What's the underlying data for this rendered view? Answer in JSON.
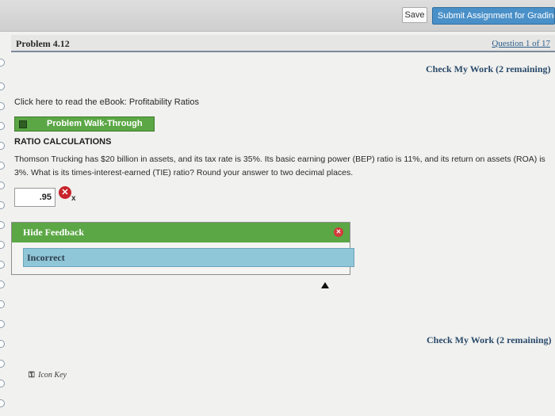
{
  "toolbar": {
    "save_label": "Save",
    "submit_label": "Submit Assignment for Grading",
    "accent_color": "#4a90c8"
  },
  "header": {
    "problem_title": "Problem 4.12",
    "question_nav": "Question 1 of 17"
  },
  "check_work": {
    "top_label": "Check My Work (2 remaining)",
    "bottom_label": "Check My Work (2 remaining)"
  },
  "content": {
    "ebook_link": "Click here to read the eBook: Profitability Ratios",
    "walkthrough_label": "Problem Walk-Through",
    "section_heading": "RATIO CALCULATIONS",
    "question": "Thomson Trucking has $20 billion in assets, and its tax rate is 35%. Its basic earning power (BEP) ratio is 11%, and its return on assets (ROA) is 3%. What is its times-interest-earned (TIE) ratio? Round your answer to two decimal places.",
    "answer_value": ".95",
    "answer_mark": "x"
  },
  "feedback": {
    "toggle_label": "Hide Feedback",
    "status": "Incorrect",
    "header_color": "#5ba745",
    "body_color": "#8fc6d8"
  },
  "footer": {
    "icon_key_label": "Icon Key"
  }
}
